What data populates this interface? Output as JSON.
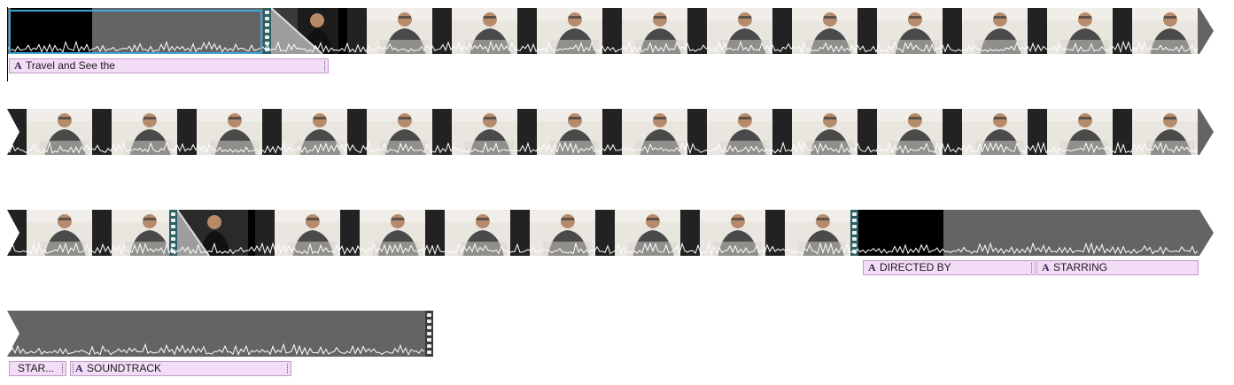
{
  "timeline": {
    "title_clips": {
      "row1_title": "Travel and See the",
      "row3_directed": "DIRECTED BY",
      "row3_starring": "STARRING",
      "row4_starring_short": "STAR...",
      "row4_soundtrack": "SOUNDTRACK"
    },
    "title_icon_glyph": "A",
    "icons": {
      "title_icon": "text-title-icon",
      "transition_icon": "filmstrip-transition-icon",
      "end_arrow": "clip-end-arrow-icon",
      "start_notch": "clip-start-notch-icon"
    },
    "colors": {
      "selection_border": "#39a9dc",
      "title_clip_fill": "#f3dcf6",
      "clip_gray": "#646464",
      "waveform": "#ffffff"
    }
  }
}
